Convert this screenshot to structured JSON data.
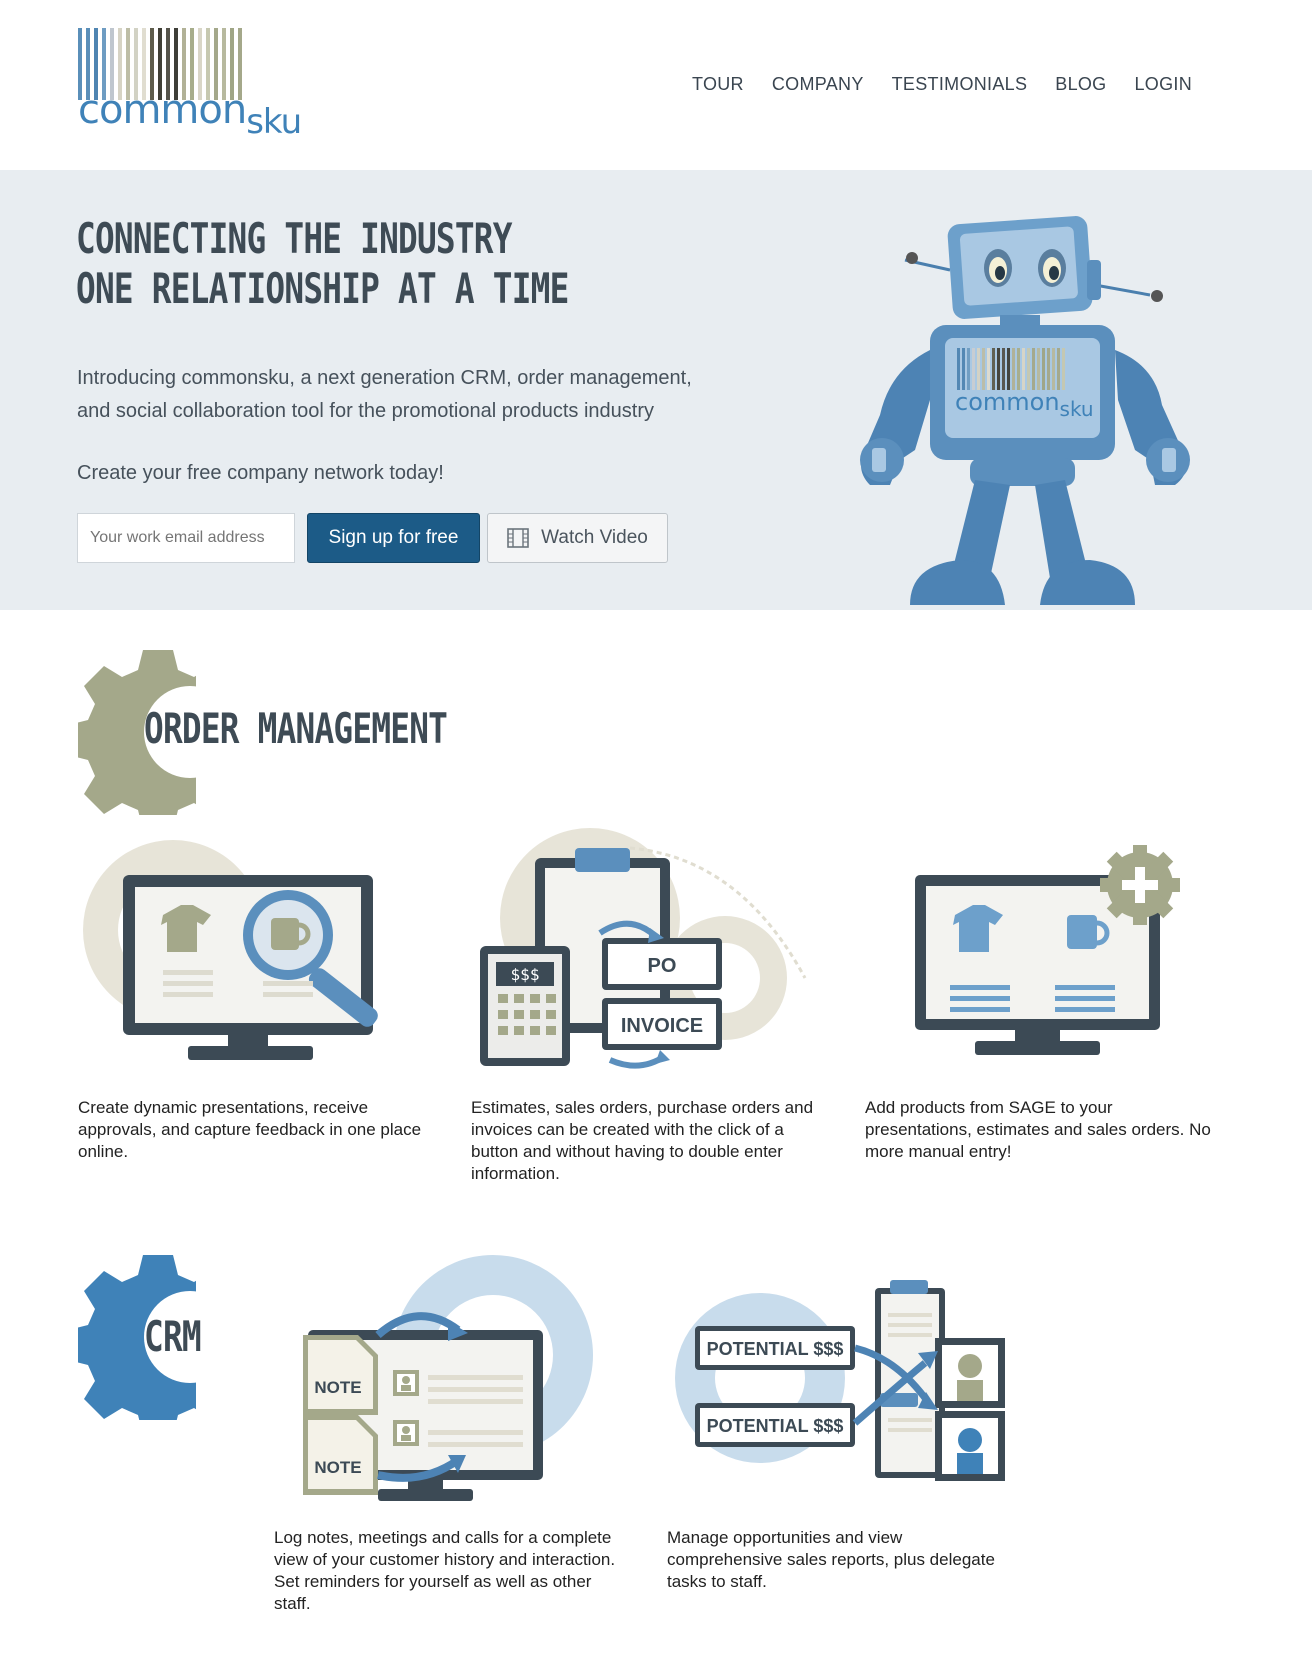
{
  "brand": {
    "name_main": "common",
    "name_sku": "sku",
    "colors": {
      "blue": "#3f82b8",
      "dark_blue": "#1c5b87",
      "olive": "#a4a88a",
      "hero_bg": "#e8edf1",
      "text_dark": "#3e4b55"
    }
  },
  "nav": {
    "items": [
      "TOUR",
      "COMPANY",
      "TESTIMONIALS",
      "BLOG",
      "LOGIN"
    ]
  },
  "hero": {
    "title_line1": "CONNECTING THE INDUSTRY",
    "title_line2": "ONE RELATIONSHIP AT A TIME",
    "intro": "Introducing commonsku, a next generation CRM, order management, and social collaboration tool for the promotional products industry",
    "cta": "Create your free company network today!",
    "email_placeholder": "Your work email address",
    "signup_label": "Sign up for free",
    "video_label": "Watch Video",
    "robot_logo_main": "common",
    "robot_logo_sku": "sku"
  },
  "order_management": {
    "title": "ORDER MANAGEMENT",
    "features": [
      {
        "icon": "monitor-search-icon",
        "text": "Create dynamic presentations, receive approvals, and capture feedback in one place online."
      },
      {
        "icon": "po-invoice-icon",
        "text": "Estimates, sales orders, purchase orders and invoices can be created with the click of a button and without having to double enter information.",
        "labels": {
          "calc": "$$$",
          "po": "PO",
          "invoice": "INVOICE"
        }
      },
      {
        "icon": "monitor-add-icon",
        "text": "Add products from SAGE to your presentations, estimates and sales orders. No more manual entry!"
      }
    ]
  },
  "crm": {
    "title": "CRM",
    "features": [
      {
        "icon": "notes-monitor-icon",
        "text": "Log notes, meetings and calls for a complete view of your customer history and interaction. Set reminders for yourself as well as other staff.",
        "labels": {
          "note1": "NOTE",
          "note2": "NOTE"
        }
      },
      {
        "icon": "potential-sales-icon",
        "text": "Manage opportunities and view comprehensive sales reports, plus delegate tasks to staff.",
        "labels": {
          "pot1": "POTENTIAL $$$",
          "pot2": "POTENTIAL $$$"
        }
      }
    ]
  }
}
